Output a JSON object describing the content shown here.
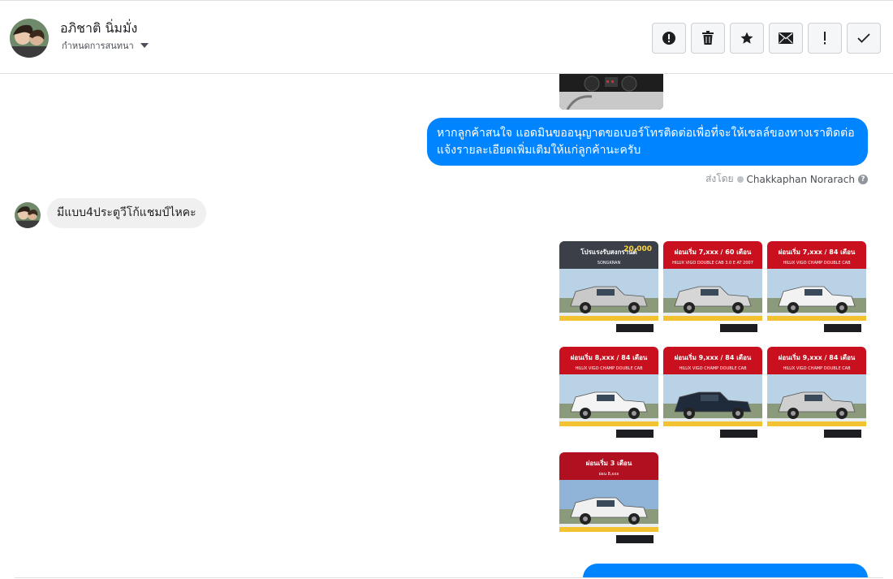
{
  "header": {
    "contact_name": "อภิชาติ นิ่มมั่ง",
    "conversation_settings": "กำหนดการสนทนา",
    "actions": [
      {
        "name": "report-button",
        "icon": "exclamation-circle-icon"
      },
      {
        "name": "delete-button",
        "icon": "trash-icon"
      },
      {
        "name": "star-button",
        "icon": "star-icon"
      },
      {
        "name": "mark-unread-button",
        "icon": "envelope-icon"
      },
      {
        "name": "mark-important-button",
        "icon": "exclamation-icon"
      },
      {
        "name": "mark-done-button",
        "icon": "check-icon"
      }
    ]
  },
  "thread": {
    "outgoing_message": "หากลูกค้าสนใจ แอดมินขออนุญาตขอเบอร์โทรติดต่อเพื่อที่จะให้เซลล์ของทางเราติดต่อแจ้งรายละเอียดเพิ่มเติมให้แก่ลูกค้านะครับ",
    "sent_by_label": "ส่งโดย",
    "sent_by_name": "Chakkaphan Norarach",
    "incoming_message": "มีแบบ4ประตูวีโก้แชมป์ไหคะ",
    "image_grid": [
      {
        "title": "โปรแรงรับสงกรานต์",
        "subtitle": "SONGKRAN",
        "price_tag": "20,000",
        "body_color": "#c9c9c9",
        "banner": "#3b4048"
      },
      {
        "title": "ผ่อนเริ่ม 7,xxx / 60 เดือน",
        "subtitle": "HILUX VIGO DOUBLE CAB 3.0 E AT 2007",
        "body_color": "#d6d6d6",
        "banner": "#c8101e"
      },
      {
        "title": "ผ่อนเริ่ม 7,xxx / 84 เดือน",
        "subtitle": "HILUX VIGO CHAMP DOUBLE CAB",
        "body_color": "#f2f2f2",
        "banner": "#c8101e"
      },
      {
        "title": "ผ่อนเริ่ม 8,xxx / 84 เดือน",
        "subtitle": "HILUX VIGO CHAMP DOUBLE CAB",
        "body_color": "#f4f4f4",
        "banner": "#c8101e"
      },
      {
        "title": "ผ่อนเริ่ม 9,xxx / 84 เดือน",
        "subtitle": "HILUX VIGO CHAMP DOUBLE CAB",
        "body_color": "#1f2a3a",
        "banner": "#c8101e"
      },
      {
        "title": "ผ่อนเริ่ม 9,xxx / 84 เดือน",
        "subtitle": "HILUX VIGO CHAMP DOUBLE CAB",
        "body_color": "#cfcfcf",
        "banner": "#c8101e"
      },
      {
        "title": "ผ่อนเริ่ม 3 เดือน",
        "subtitle": "ผ่อน 8,xxx",
        "body_color": "#f0f0f0",
        "banner": "#b01020"
      }
    ]
  },
  "colors": {
    "messenger_blue": "#0084ff",
    "incoming_bubble": "#f1f0f0",
    "border": "#dddfe2"
  }
}
